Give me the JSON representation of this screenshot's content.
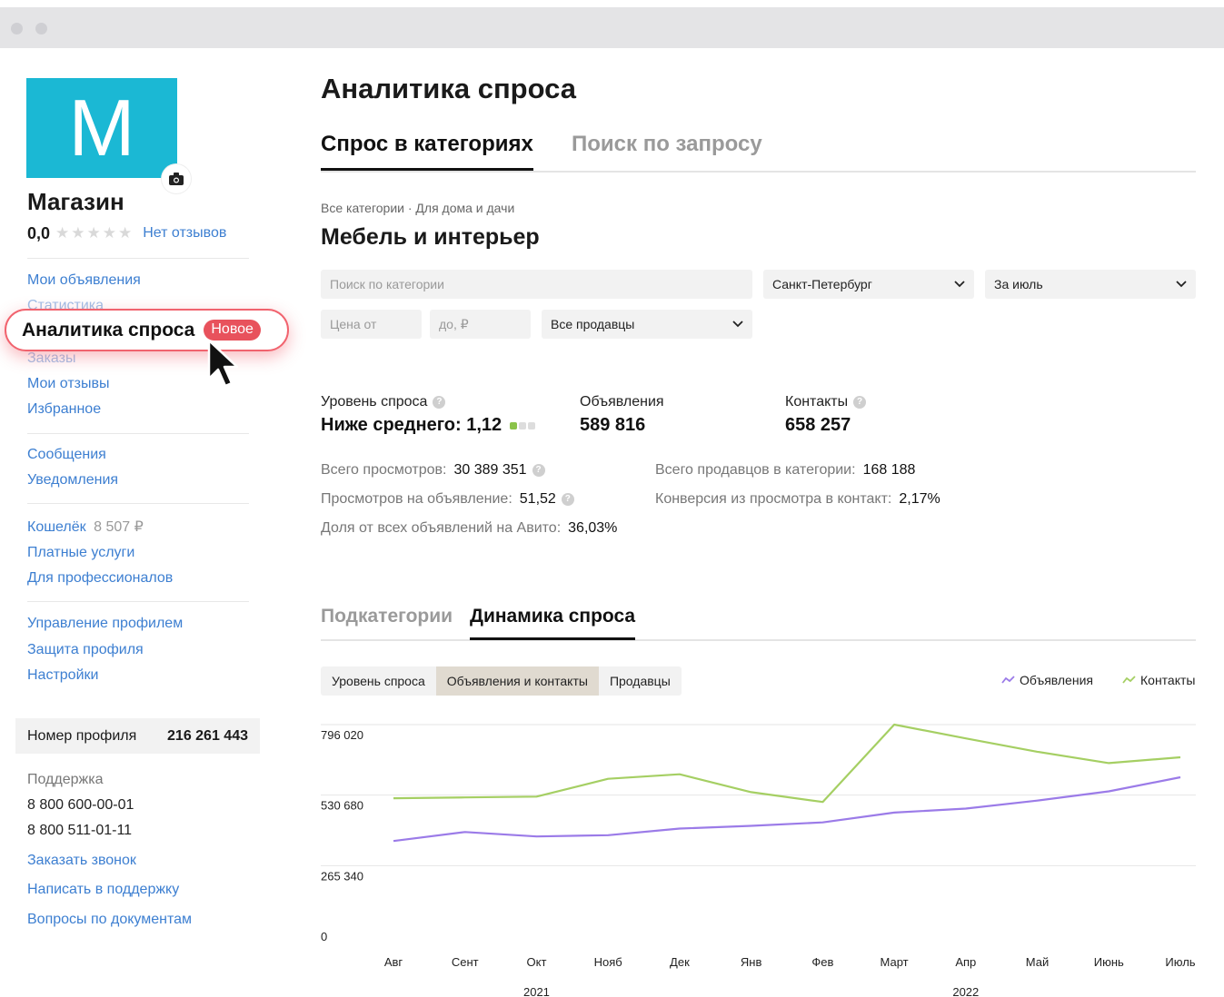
{
  "sidebar": {
    "avatar_letter": "M",
    "shop_name": "Магазин",
    "rating": "0,0",
    "stars": "★★★★★",
    "no_reviews": "Нет отзывов",
    "group1": [
      "Мои объявления",
      "Статистика"
    ],
    "highlight_label": "Аналитика спроса",
    "highlight_badge": "Новое",
    "group1b": [
      "Заказы",
      "Мои отзывы",
      "Избранное"
    ],
    "group2": [
      "Сообщения",
      "Уведомления"
    ],
    "wallet_label": "Кошелёк",
    "wallet_amount": "8 507 ₽",
    "group3": [
      "Платные услуги",
      "Для профессионалов"
    ],
    "group4": [
      "Управление профилем",
      "Защита профиля",
      "Настройки"
    ],
    "profile_label": "Номер профиля",
    "profile_number": "216 261 443",
    "support_label": "Поддержка",
    "phones": [
      "8 800 600-00-01",
      "8 800 511-01-11"
    ],
    "support_links": [
      "Заказать звонок",
      "Написать в поддержку",
      "Вопросы по документам"
    ]
  },
  "main": {
    "title": "Аналитика спроса",
    "tabs": [
      {
        "label": "Спрос в категориях",
        "active": true
      },
      {
        "label": "Поиск по запросу",
        "active": false
      }
    ],
    "breadcrumbs": "Все категории · Для дома и дачи",
    "category": "Мебель и интерьер",
    "search_placeholder": "Поиск по категории",
    "city": "Санкт-Петербург",
    "period": "За июль",
    "price_from_placeholder": "Цена от",
    "price_to_placeholder": "до, ₽",
    "sellers": "Все продавцы",
    "stats": {
      "demand_label": "Уровень спроса",
      "demand_value": "Ниже среднего: 1,12",
      "demand_level": 1,
      "demand_level_max": 3,
      "ads_label": "Объявления",
      "ads_value": "589 816",
      "contacts_label": "Контакты",
      "contacts_value": "658 257"
    },
    "kv": [
      {
        "label": "Всего просмотров:",
        "value": "30 389 351"
      },
      {
        "label": "Просмотров на объявление:",
        "value": "51,52"
      },
      {
        "label": "Доля от всех объявлений на Авито:",
        "value": "36,03%"
      },
      {
        "label": "Всего продавцов в категории:",
        "value": "168 188"
      },
      {
        "label": "Конверсия из просмотра в контакт:",
        "value": "2,17%"
      }
    ],
    "sub_tabs": [
      {
        "label": "Подкатегории",
        "active": false
      },
      {
        "label": "Динамика спроса",
        "active": true
      }
    ],
    "segments": [
      {
        "label": "Уровень спроса",
        "active": false
      },
      {
        "label": "Объявления и контакты",
        "active": true
      },
      {
        "label": "Продавцы",
        "active": false
      }
    ],
    "legend": [
      "Объявления",
      "Контакты"
    ]
  },
  "colors": {
    "accent_blue": "#3d7fd1",
    "avatar_bg": "#1bb8d4",
    "highlight_red": "#e8525c",
    "series_ads": "#9b7be8",
    "series_contacts": "#a5cf63"
  },
  "chart_data": {
    "type": "line",
    "categories": [
      "Авг",
      "Сент",
      "Окт",
      "Нояб",
      "Дек",
      "Янв",
      "Фев",
      "Март",
      "Апр",
      "Май",
      "Июнь",
      "Июль"
    ],
    "year_labels": [
      {
        "label": "2021",
        "at": 2
      },
      {
        "label": "2022",
        "at": 8
      }
    ],
    "y_ticks": [
      0,
      265340,
      530680,
      796020
    ],
    "y_tick_labels": [
      "0",
      "265 340",
      "530 680",
      "796 020"
    ],
    "ylim": [
      0,
      796020
    ],
    "series": [
      {
        "name": "Объявления",
        "color": "#9b7be8",
        "values": [
          358000,
          392000,
          375000,
          380000,
          405000,
          415000,
          428000,
          465000,
          480000,
          510000,
          545000,
          598000
        ]
      },
      {
        "name": "Контакты",
        "color": "#a5cf63",
        "values": [
          519000,
          522000,
          525000,
          592000,
          609000,
          542000,
          505000,
          796000,
          744000,
          694000,
          651000,
          673000
        ]
      }
    ],
    "grid": true,
    "legend_position": "top-right"
  }
}
